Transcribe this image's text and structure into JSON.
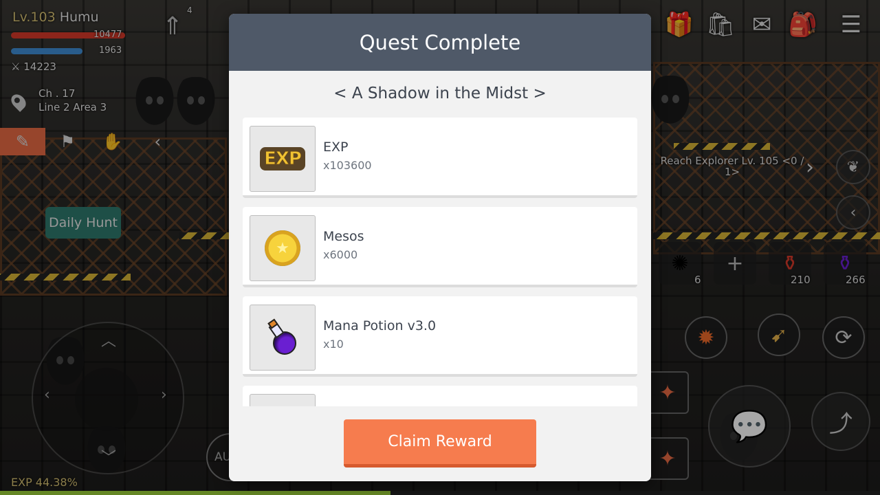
{
  "player": {
    "level": "Lv.103",
    "name": "Humu",
    "hp": "10477",
    "mp": "1963",
    "combat_power": "14223",
    "channel": "Ch . 17",
    "area": "Line 2 Area 3"
  },
  "hud": {
    "levelup_count": "4",
    "daily_hunt": "Daily Hunt",
    "exp_label": "EXP 44.38%",
    "exp_percent": 44.38,
    "auto_label": "AU",
    "quest_tracker": "Reach Explorer Lv. 105 <0 / 1>",
    "hp_potion_count": "210",
    "mp_potion_count": "266",
    "buff_count": "6"
  },
  "dialog": {
    "title": "Quest Complete",
    "quest_name": "< A Shadow in the Midst >",
    "rewards": [
      {
        "name": "EXP",
        "qty": "x103600",
        "icon": "exp-icon"
      },
      {
        "name": "Mesos",
        "qty": "x6000",
        "icon": "meso-coin-icon"
      },
      {
        "name": "Mana Potion v3.0",
        "qty": "x10",
        "icon": "mana-potion-icon"
      },
      {
        "name": "",
        "qty": "",
        "icon": "item-icon"
      }
    ],
    "exp_badge_text": "EXP",
    "claim_label": "Claim Reward"
  },
  "colors": {
    "header": "#4f5968",
    "claim_button": "#f67c4e",
    "hp": "#d83a2a",
    "mp": "#3f8ed6"
  }
}
